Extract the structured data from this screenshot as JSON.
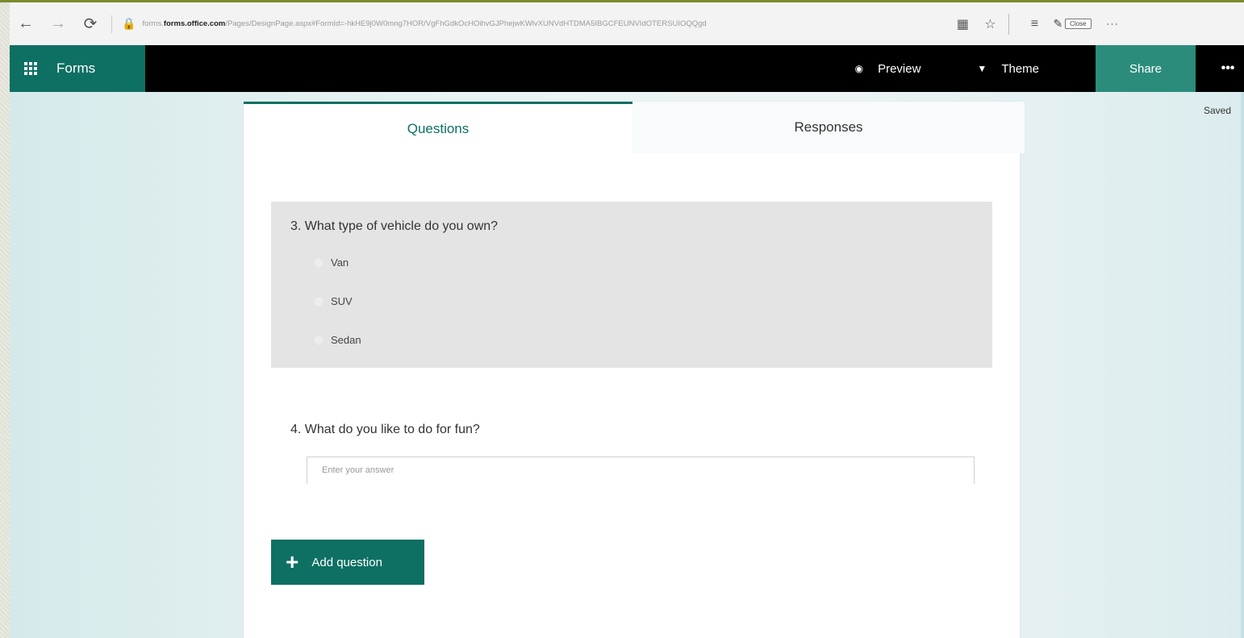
{
  "browser": {
    "url_domain": "forms.office.com",
    "url_prefix": "forms.",
    "url_rest": "/Pages/DesignPage.aspx#FormId=-hkHE9j0W0mng7HOR/VgFhGdkOcHOihvGJPhejwKWlvXUNVdHTDMA5IBGCFEUNVIdOTERSUIOQQgd",
    "close_label": "Close"
  },
  "appbar": {
    "app_name": "Forms",
    "preview_label": "Preview",
    "theme_label": "Theme",
    "share_label": "Share",
    "more_label": "•••"
  },
  "status": {
    "saved": "Saved"
  },
  "tabs": [
    {
      "label": "Questions",
      "active": true
    },
    {
      "label": "Responses",
      "active": false
    }
  ],
  "question3": {
    "title": "3. What type of vehicle do you own?",
    "options": [
      "Van",
      "SUV",
      "Sedan"
    ]
  },
  "question4": {
    "title": "4. What do you like to do for fun?",
    "placeholder": "Enter your answer"
  },
  "add_question_label": "Add question",
  "colors": {
    "brand": "#0e6f63",
    "share": "#2b8c7c",
    "appbar": "#000000",
    "selected_question_bg": "#e4e4e4"
  },
  "icons": [
    "back-arrow-icon",
    "forward-arrow-icon",
    "refresh-icon",
    "lock-icon",
    "reading-view-icon",
    "favorites-star-icon",
    "hub-icon",
    "web-note-icon",
    "more-icon",
    "waffle-icon",
    "eye-icon",
    "paint-bucket-icon",
    "plus-icon"
  ]
}
